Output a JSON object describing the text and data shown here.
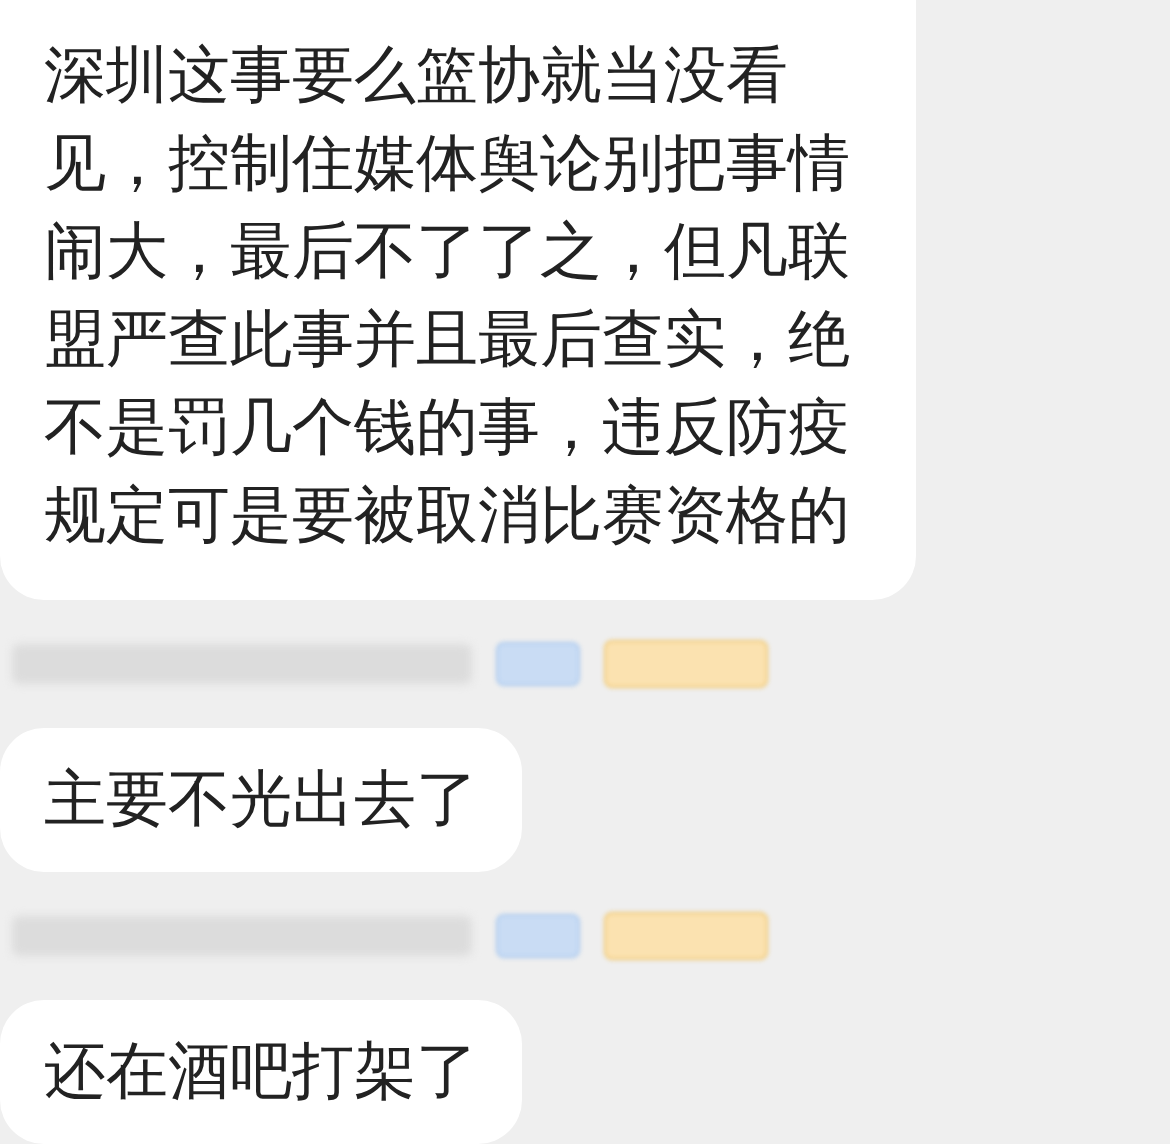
{
  "chat": [
    {
      "kind": "message",
      "text": "深圳这事要么篮协就当没看见，控制住媒体舆论别把事情闹大，最后不了了之，但凡联盟严查此事并且最后查实，绝不是罚几个钱的事，违反防疫规定可是要被取消比赛资格的"
    },
    {
      "kind": "sender"
    },
    {
      "kind": "message",
      "text": "主要不光出去了"
    },
    {
      "kind": "sender"
    },
    {
      "kind": "message",
      "text": "还在酒吧打架了"
    }
  ]
}
